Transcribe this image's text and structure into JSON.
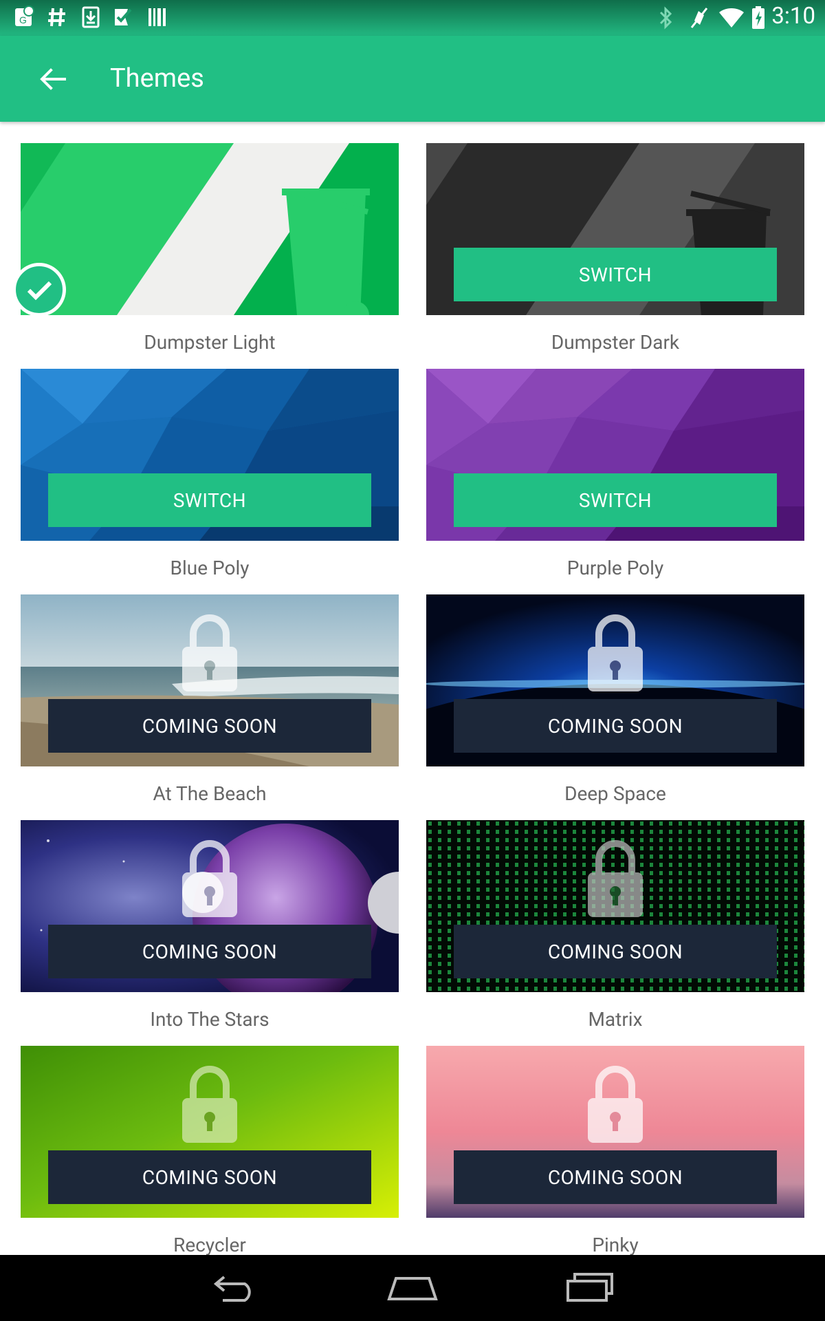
{
  "status_bar": {
    "time": "3:10"
  },
  "app_bar": {
    "title": "Themes"
  },
  "themes": [
    {
      "name": "Dumpster Light",
      "action": "",
      "selected": true
    },
    {
      "name": "Dumpster Dark",
      "action": "SWITCH"
    },
    {
      "name": "Blue Poly",
      "action": "SWITCH"
    },
    {
      "name": "Purple Poly",
      "action": "SWITCH"
    },
    {
      "name": "At The Beach",
      "action": "COMING SOON"
    },
    {
      "name": "Deep Space",
      "action": "COMING SOON"
    },
    {
      "name": "Into The Stars",
      "action": "COMING SOON"
    },
    {
      "name": "Matrix",
      "action": "COMING SOON"
    },
    {
      "name": "Recycler",
      "action": "COMING SOON"
    },
    {
      "name": "Pinky",
      "action": "COMING SOON"
    }
  ]
}
